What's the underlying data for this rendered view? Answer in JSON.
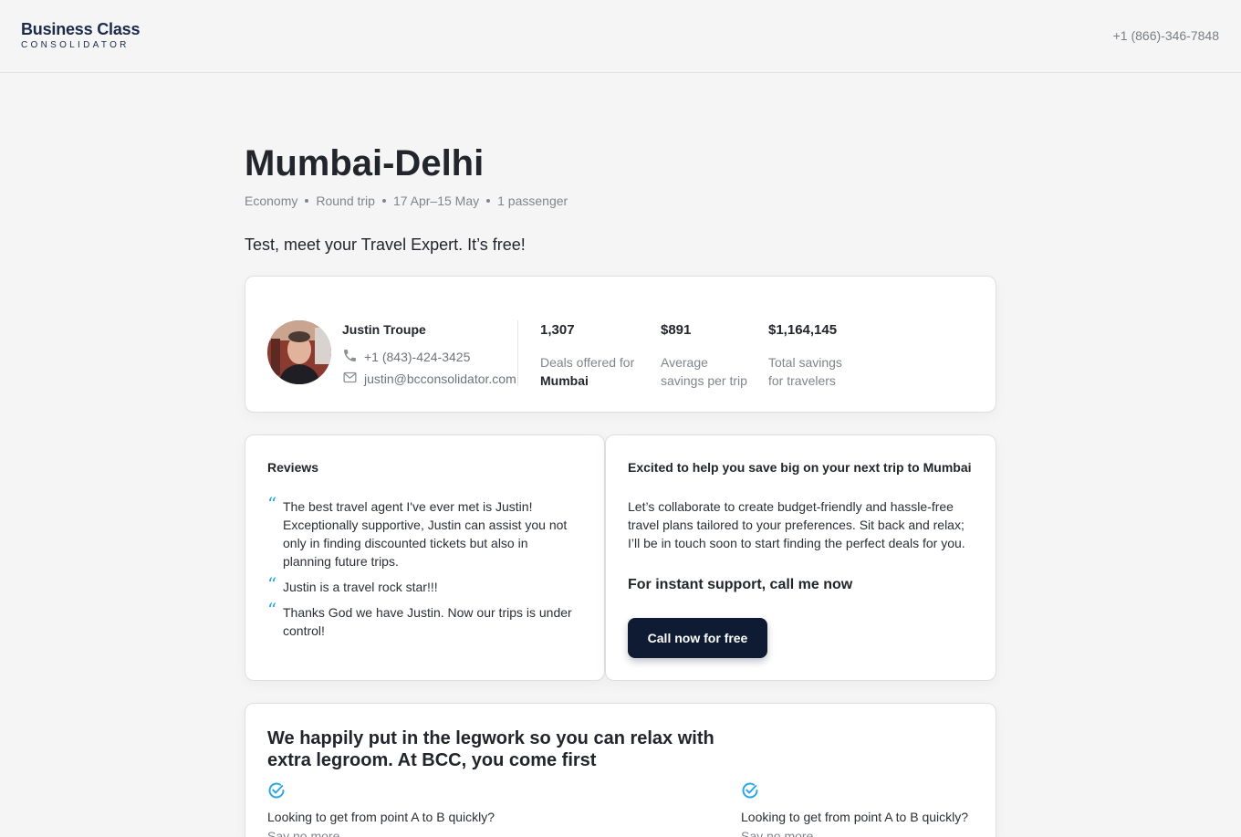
{
  "header": {
    "logo_main": "Business Class",
    "logo_sub": "CONSOLIDATOR",
    "phone": "+1 (866)-346-7848"
  },
  "trip": {
    "title": "Mumbai-Delhi",
    "meta": [
      "Economy",
      "Round trip",
      "17 Apr–15 May",
      "1 passenger"
    ]
  },
  "intro": "Test, meet your Travel Expert. It’s free!",
  "agent": {
    "name": "Justin Troupe",
    "phone": "+1 (843)-424-3425",
    "email": "justin@bcconsolidator.com"
  },
  "stats": [
    {
      "value": "1,307",
      "label_line1": "Deals offered for",
      "label_line2": "Mumbai"
    },
    {
      "value": "$891",
      "label_line1": "Average",
      "label_line2": "savings per trip"
    },
    {
      "value": "$1,164,145",
      "label_line1": "Total savings",
      "label_line2": "for travelers"
    }
  ],
  "reviews": {
    "heading": "Reviews",
    "items": [
      "The best travel agent I've ever met is Justin! Exceptionally supportive, Justin can assist you not only in finding discounted tickets but also in planning future trips.",
      "Justin is a travel rock star!!!",
      "Thanks God we have Justin. Now our trips is under control!"
    ]
  },
  "help": {
    "heading": "Excited to help you save big on your next trip to Mumbai",
    "body": "Let’s collaborate to create budget-friendly and hassle-free travel plans tailored to your preferences. Sit back and relax; I’ll be in touch soon to start finding the perfect deals for you.",
    "sub": "For instant support, call me now",
    "button": "Call now for free"
  },
  "legwork": {
    "title": "We happily put in the legwork so you can relax with extra legroom. At BCC, you come first",
    "features": [
      {
        "question": "Looking to get from point A to B quickly?",
        "answer": "Say no more"
      },
      {
        "question": "Looking to get from point A to B quickly?",
        "answer": "Say no more"
      }
    ]
  },
  "colors": {
    "accent": "#2aa7e6",
    "button_bg": "#0f1b33",
    "brand": "#1b2a4a"
  }
}
